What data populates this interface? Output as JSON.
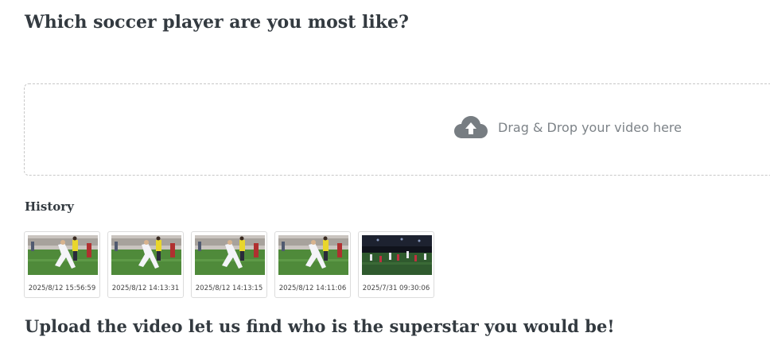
{
  "page": {
    "title": "Which soccer player are you most like?",
    "bottom_heading": "Upload the video let us find who is the superstar you would be!"
  },
  "dropzone": {
    "icon": "cloud-upload-icon",
    "text": "Drag & Drop your video here"
  },
  "history": {
    "label": "History",
    "items": [
      {
        "timestamp": "2025/8/12 15:56:59",
        "thumbnail": "soccer-match-thumbnail"
      },
      {
        "timestamp": "2025/8/12 14:13:31",
        "thumbnail": "soccer-match-thumbnail"
      },
      {
        "timestamp": "2025/8/12 14:13:15",
        "thumbnail": "soccer-match-thumbnail"
      },
      {
        "timestamp": "2025/8/12 14:11:06",
        "thumbnail": "soccer-match-thumbnail"
      },
      {
        "timestamp": "2025/7/31 09:30:06",
        "thumbnail": "soccer-night-match-thumbnail"
      }
    ]
  },
  "colors": {
    "text": "#333a40",
    "muted": "#7d8388",
    "border": "#c8c8c8",
    "pitch": "#4f8a3a"
  }
}
